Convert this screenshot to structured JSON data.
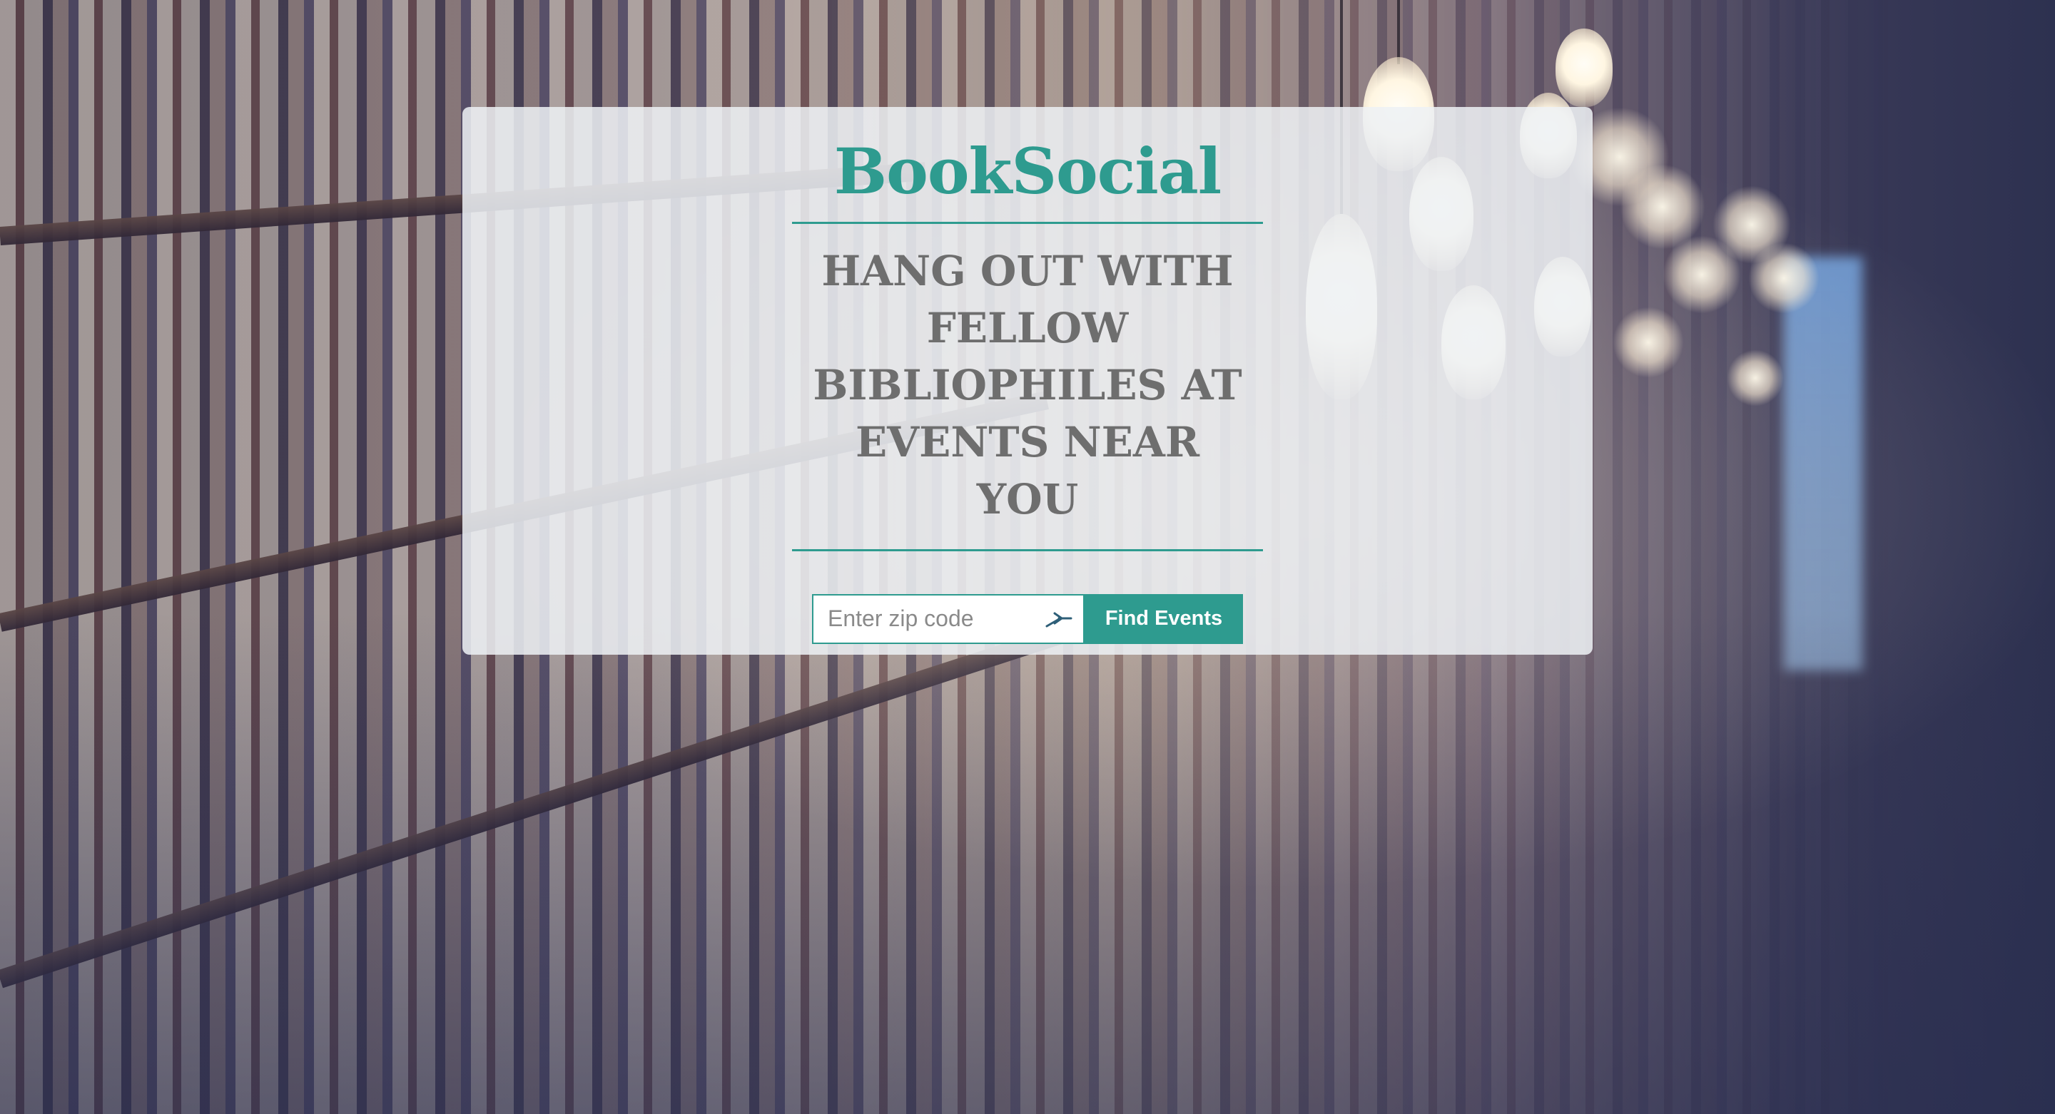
{
  "app": {
    "brand": "BookSocial",
    "tagline": "Hang out with fellow bibliophiles at events near you"
  },
  "search": {
    "zip_placeholder": "Enter zip code",
    "zip_value": "",
    "locate_icon": "location-arrow-icon",
    "button_label": "Find Events"
  },
  "colors": {
    "accent": "#2e9b8f",
    "tagline": "#6e6e6e",
    "panel": "rgba(238,241,244,0.86)"
  }
}
